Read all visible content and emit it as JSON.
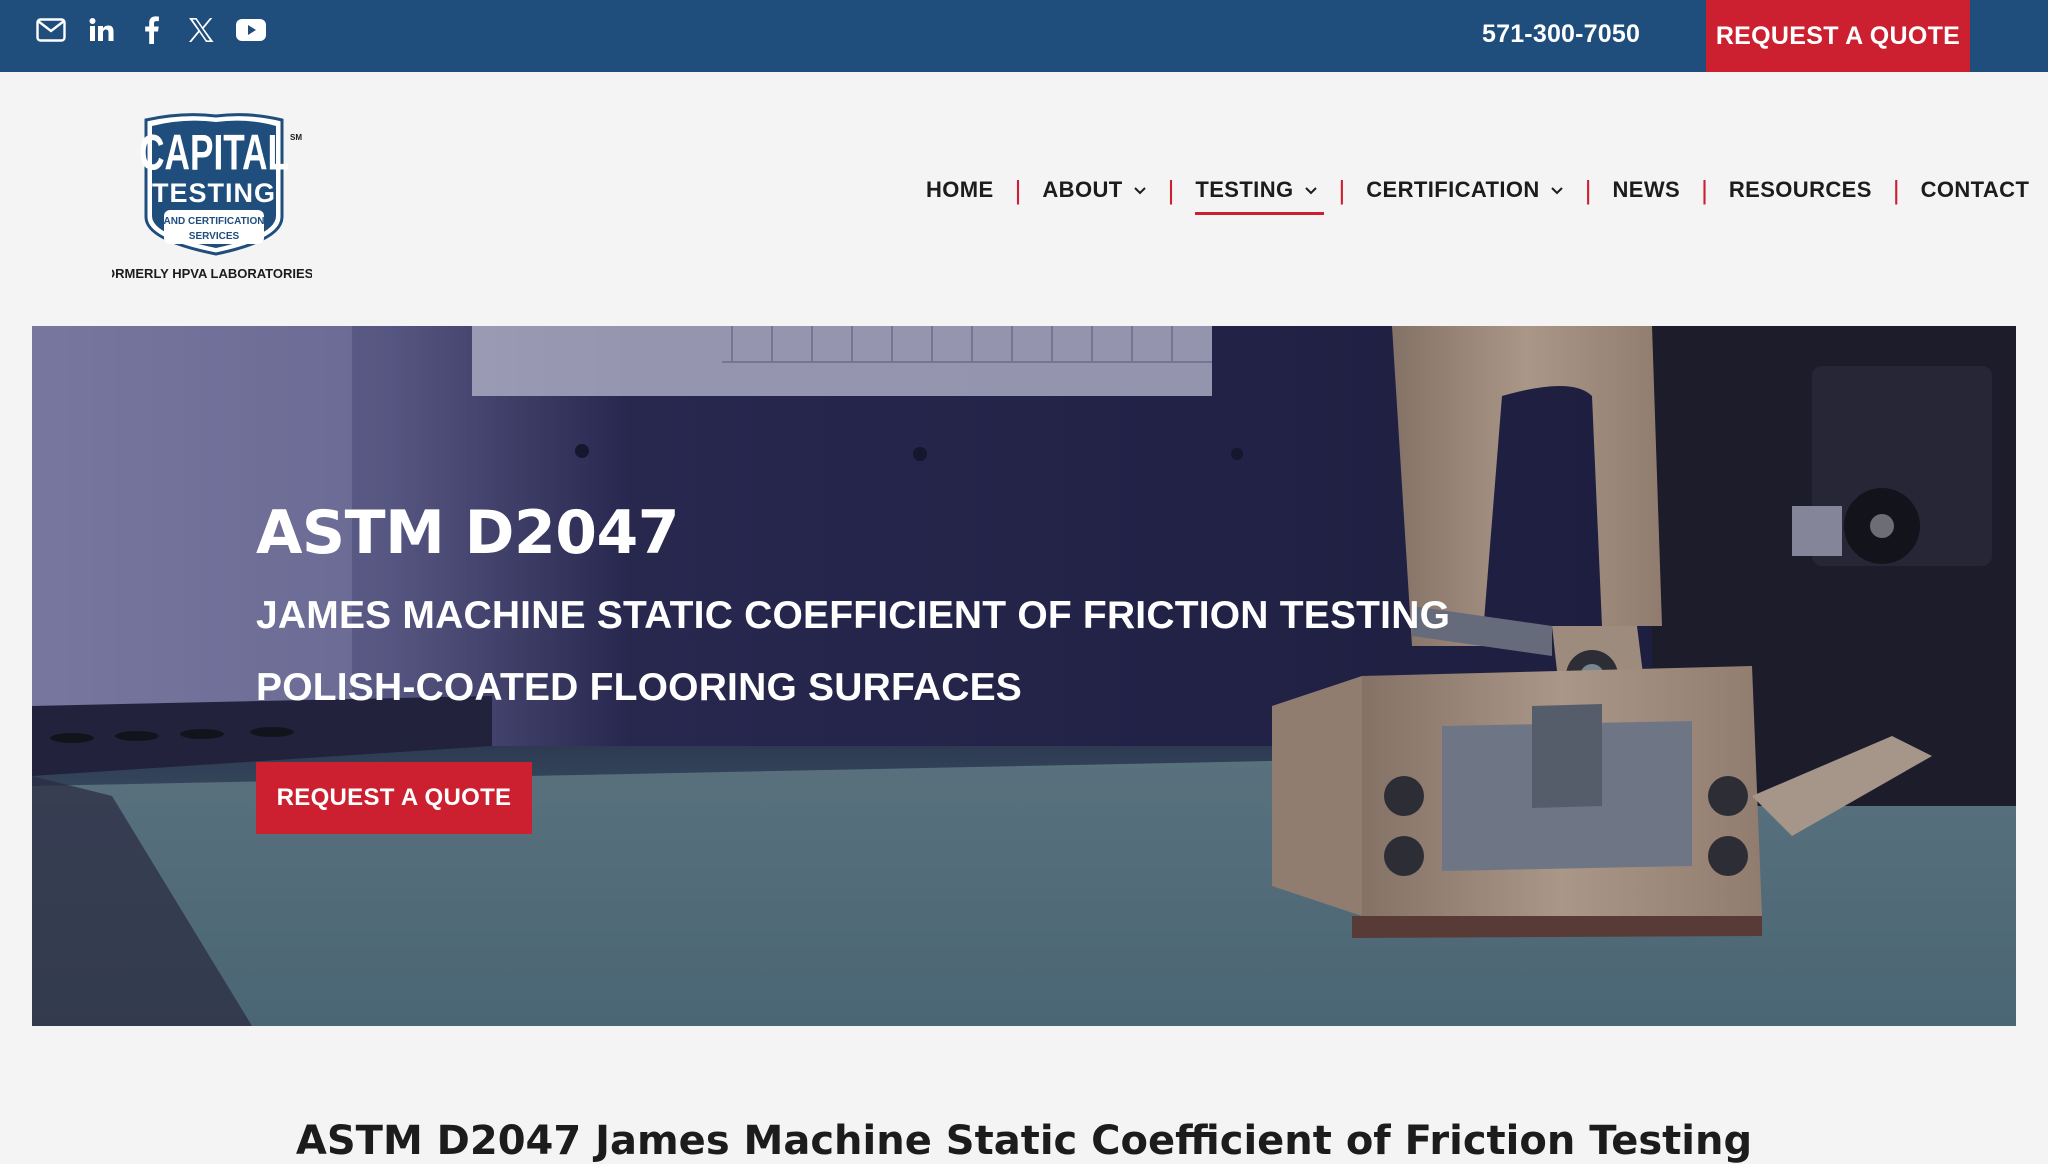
{
  "topbar": {
    "social": [
      {
        "icon": "email-icon"
      },
      {
        "icon": "linkedin-icon"
      },
      {
        "icon": "facebook-icon"
      },
      {
        "icon": "x-twitter-icon"
      },
      {
        "icon": "youtube-icon"
      }
    ],
    "phone": "571-300-7050",
    "quote_label": "REQUEST A QUOTE"
  },
  "logo": {
    "line1": "CAPITAL",
    "line2": "TESTING",
    "line3": "AND CERTIFICATION",
    "line4": "SERVICES",
    "mark": "SM",
    "tagline": "FORMERLY HPVA LABORATORIES®"
  },
  "nav": {
    "items": [
      {
        "label": "HOME",
        "dropdown": false,
        "active": false
      },
      {
        "label": "ABOUT",
        "dropdown": true,
        "active": false
      },
      {
        "label": "TESTING",
        "dropdown": true,
        "active": true
      },
      {
        "label": "CERTIFICATION",
        "dropdown": true,
        "active": false
      },
      {
        "label": "NEWS",
        "dropdown": false,
        "active": false
      },
      {
        "label": "RESOURCES",
        "dropdown": false,
        "active": false
      },
      {
        "label": "CONTACT",
        "dropdown": false,
        "active": false
      }
    ]
  },
  "hero": {
    "title": "ASTM D2047",
    "subtitle_line1": "JAMES MACHINE STATIC COEFFICIENT OF FRICTION TESTING",
    "subtitle_line2": "POLISH-COATED FLOORING SURFACES",
    "cta_label": "REQUEST A QUOTE"
  },
  "section": {
    "title": "ASTM D2047 James Machine Static Coefficient of Friction Testing"
  },
  "colors": {
    "brand_blue": "#1f4e7d",
    "brand_red": "#cc1f2f",
    "page_bg": "#f4f4f4"
  }
}
